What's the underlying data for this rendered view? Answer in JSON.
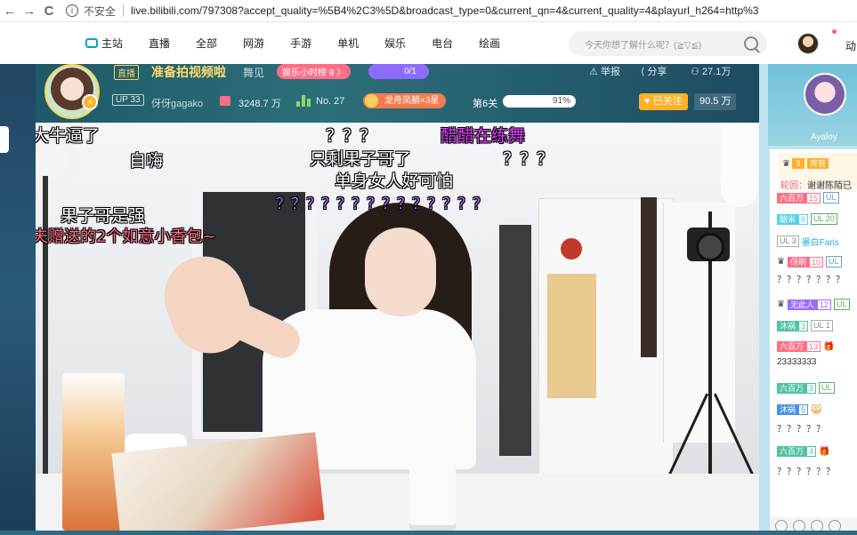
{
  "browser": {
    "back": "←",
    "forward": "→",
    "reload": "C",
    "info": "i",
    "security": "不安全",
    "url": "live.bilibili.com/797308?accept_quality=%5B4%2C3%5D&broadcast_type=0&current_qn=4&current_quality=4&playurl_h264=http%3"
  },
  "nav": {
    "home": "主站",
    "links": [
      "直播",
      "全部",
      "网游",
      "手游",
      "单机",
      "娱乐",
      "电台",
      "绘画"
    ],
    "search_placeholder": "今天你想了解什么呢？(≧▽≦)",
    "dynamic": "动"
  },
  "room": {
    "live_tag": "直播",
    "title": "准备拍视频啦",
    "area": "舞见",
    "rank_badge": "娱乐小时榜 9 〉",
    "pk_badge": "0/1",
    "report": "举报",
    "share": "分享",
    "viewers": "27.1万",
    "up_level": "UP 33",
    "streamer_name": "伢伢gagako",
    "gift_value": "3248.7 万",
    "rank_no": "No. 27",
    "guard_badge": "龙舟凤艄×3星",
    "stage": "第6关",
    "progress_percent": 91,
    "progress_label": "91%",
    "follow": "已关注",
    "fans": "90.5 万"
  },
  "danmaku": [
    {
      "text": "大牛逼了",
      "color": "#ffffff"
    },
    {
      "text": "？？？",
      "color": "#ffffff"
    },
    {
      "text": "醋醋在练舞",
      "color": "#e040fb"
    },
    {
      "text": "自嗨",
      "color": "#ffffff"
    },
    {
      "text": "只剩果子哥了",
      "color": "#ffffff"
    },
    {
      "text": "？？？",
      "color": "#ffffff"
    },
    {
      "text": "单身女人好可怕",
      "color": "#ffffff"
    },
    {
      "text": "？？？？？？？？？？？？？？",
      "color": "#b26bff"
    },
    {
      "text": "果子哥是强",
      "color": "#ffffff"
    },
    {
      "text": "夫赠送的2个如意小香包~",
      "color": "#ff6e86"
    }
  ],
  "panel": {
    "anchor_name": "Ayaloy",
    "notice_icon": "9",
    "notice_tag": "房管",
    "notice_text_label": "轮回：",
    "notice_text": "谢谢陈陌已",
    "messages": [
      {
        "medal": "六百万",
        "medal_color": "#ff6e86",
        "level": "15",
        "ul": "UL",
        "name": ""
      },
      {
        "medal": "醋米",
        "medal_color": "#5ad1e8",
        "level": "8",
        "ul": "UL 20",
        "name": ""
      },
      {
        "medal": "",
        "medal_color": "",
        "level": "",
        "ul": "UL 3",
        "name": "墨白Faris"
      },
      {
        "medal": "伢刷",
        "medal_color": "#ff6e86",
        "level": "10",
        "ul": "UL",
        "name": ""
      },
      {
        "medal": "无此人",
        "medal_color": "#9b6bff",
        "level": "12",
        "ul": "UL",
        "name": ""
      },
      {
        "medal": "沐祸",
        "medal_color": "#4fc3a1",
        "level": "3",
        "ul": "UL 1",
        "name": ""
      },
      {
        "medal": "六百万",
        "medal_color": "#ff6e86",
        "level": "13",
        "ul": "",
        "name": ""
      },
      {
        "medal": "六百万",
        "medal_color": "#4fc3a1",
        "level": "3",
        "ul": "UL",
        "name": ""
      },
      {
        "medal": "沐祸",
        "medal_color": "#4a90e2",
        "level": "5",
        "ul": "",
        "name": ""
      },
      {
        "medal": "六百万",
        "medal_color": "#4fc3a1",
        "level": "4",
        "ul": "",
        "name": ""
      }
    ],
    "texts": [
      "？？？？？？？",
      "23333333",
      "？？？？？",
      "？？？？？？"
    ]
  }
}
